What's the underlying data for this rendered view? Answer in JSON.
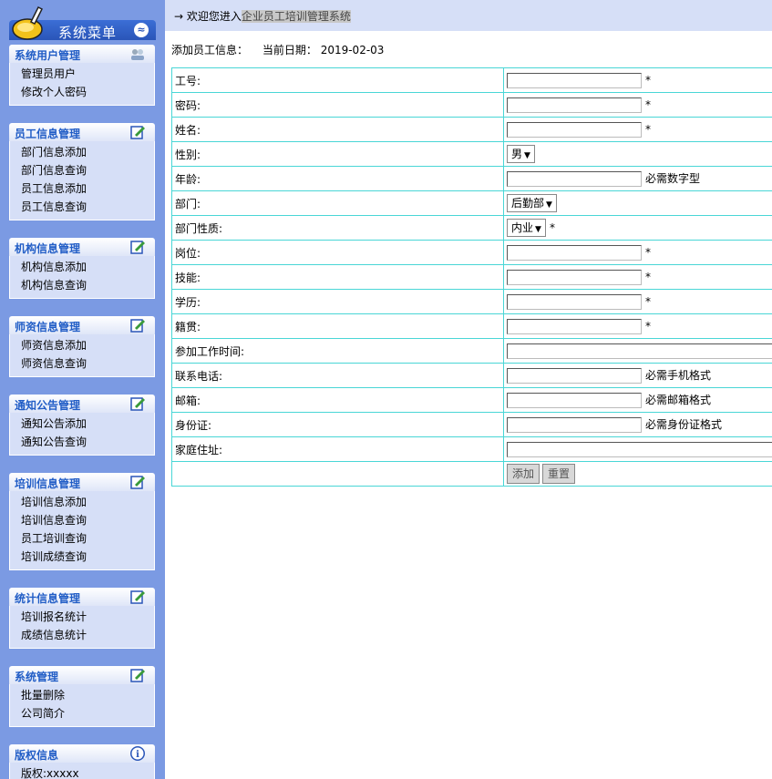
{
  "sidebar": {
    "title": "系统菜单",
    "sections": [
      {
        "title": "系统用户管理",
        "items": [
          "管理员用户",
          "修改个人密码"
        ]
      },
      {
        "title": "员工信息管理",
        "items": [
          "部门信息添加",
          "部门信息查询",
          "员工信息添加",
          "员工信息查询"
        ]
      },
      {
        "title": "机构信息管理",
        "items": [
          "机构信息添加",
          "机构信息查询"
        ]
      },
      {
        "title": "师资信息管理",
        "items": [
          "师资信息添加",
          "师资信息查询"
        ]
      },
      {
        "title": "通知公告管理",
        "items": [
          "通知公告添加",
          "通知公告查询"
        ]
      },
      {
        "title": "培训信息管理",
        "items": [
          "培训信息添加",
          "培训信息查询",
          "员工培训查询",
          "培训成绩查询"
        ]
      },
      {
        "title": "统计信息管理",
        "items": [
          "培训报名统计",
          "成绩信息统计"
        ]
      },
      {
        "title": "系统管理",
        "items": [
          "批量删除",
          "公司简介"
        ]
      },
      {
        "title": "版权信息",
        "items": [
          "版权:xxxxx"
        ]
      }
    ]
  },
  "topbar": {
    "arrow": "→",
    "welcome": "欢迎您进入",
    "system_name": "企业员工培训管理系统"
  },
  "info": {
    "heading": "添加员工信息：",
    "date_label": "当前日期：",
    "date": "2019-02-03"
  },
  "form": {
    "fields": [
      {
        "label": "工号:",
        "type": "text",
        "value": "",
        "suffix": "*"
      },
      {
        "label": "密码:",
        "type": "text",
        "value": "",
        "suffix": "*"
      },
      {
        "label": "姓名:",
        "type": "text",
        "value": "",
        "suffix": "*"
      },
      {
        "label": "性别:",
        "type": "select",
        "value": "男",
        "suffix": ""
      },
      {
        "label": "年龄:",
        "type": "text",
        "value": "",
        "suffix": "必需数字型"
      },
      {
        "label": "部门:",
        "type": "select",
        "value": "后勤部",
        "suffix": ""
      },
      {
        "label": "部门性质:",
        "type": "select",
        "value": "内业",
        "suffix": "*"
      },
      {
        "label": "岗位:",
        "type": "text",
        "value": "",
        "suffix": "*"
      },
      {
        "label": "技能:",
        "type": "text",
        "value": "",
        "suffix": "*"
      },
      {
        "label": "学历:",
        "type": "text",
        "value": "",
        "suffix": "*"
      },
      {
        "label": "籍贯:",
        "type": "text",
        "value": "",
        "suffix": "*"
      },
      {
        "label": "参加工作时间:",
        "type": "wide",
        "value": "",
        "suffix": ""
      },
      {
        "label": "联系电话:",
        "type": "text",
        "value": "",
        "suffix": "必需手机格式"
      },
      {
        "label": "邮箱:",
        "type": "text",
        "value": "",
        "suffix": "必需邮箱格式"
      },
      {
        "label": "身份证:",
        "type": "text",
        "value": "",
        "suffix": "必需身份证格式"
      },
      {
        "label": "家庭住址:",
        "type": "wide",
        "value": "",
        "suffix": ""
      }
    ],
    "buttons": {
      "add": "添加",
      "reset": "重置"
    }
  },
  "colors": {
    "sidebar_bg": "#7b9ae3",
    "header_blue": "#2a55b8",
    "section_title": "#215dc6",
    "table_border": "#49d6d6",
    "topbar_bg": "#d6dff7"
  }
}
